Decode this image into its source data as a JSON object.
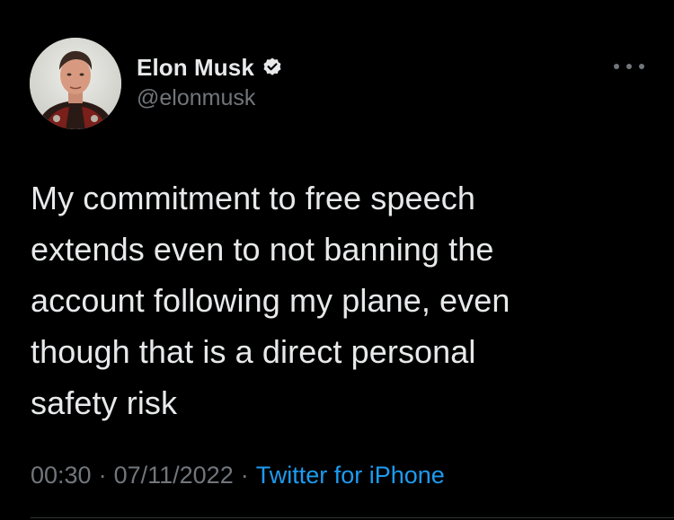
{
  "author": {
    "display_name": "Elon Musk",
    "handle": "@elonmusk",
    "verified": true,
    "avatar_icon": "profile-photo"
  },
  "menu": {
    "icon": "more-horizontal-icon"
  },
  "tweet": {
    "text": "My commitment to free speech\nextends even to not banning the\naccount following my plane, even\nthough that is a direct personal\nsafety risk"
  },
  "meta": {
    "time": "00:30",
    "date": "07/11/2022",
    "separator": "·",
    "source": "Twitter for iPhone"
  },
  "colors": {
    "background": "#000000",
    "text_primary": "#e7e9ea",
    "text_secondary": "#71767b",
    "accent": "#1d9bf0"
  }
}
